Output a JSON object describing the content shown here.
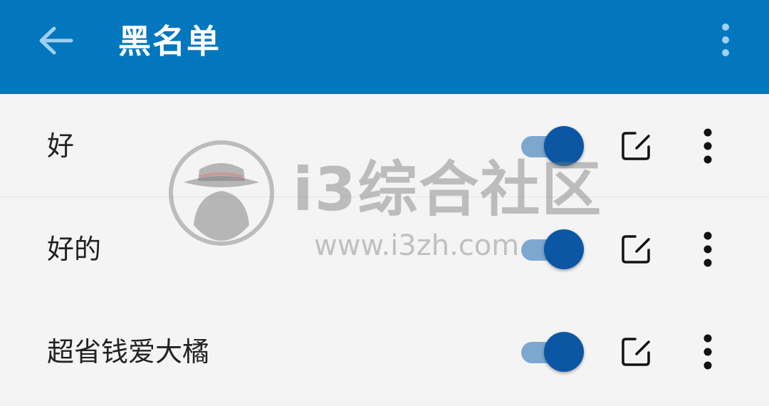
{
  "app_bar": {
    "title": "黑名单",
    "background_color": "#0277bd",
    "back_icon": "arrow-left-icon",
    "menu_icon": "more-vertical-icon"
  },
  "list": {
    "items": [
      {
        "label": "好",
        "enabled": true
      },
      {
        "label": "好的",
        "enabled": true
      },
      {
        "label": "超省钱爱大橘",
        "enabled": true
      }
    ],
    "toggle_on_color": "#0b57a4",
    "toggle_track_color": "#7ea7cf",
    "edit_icon": "edit-icon",
    "more_icon": "more-vertical-icon"
  },
  "watermark": {
    "brand": "i3综合社区",
    "url": "www.i3zh.com",
    "logo_icon": "spy-hat-icon"
  }
}
